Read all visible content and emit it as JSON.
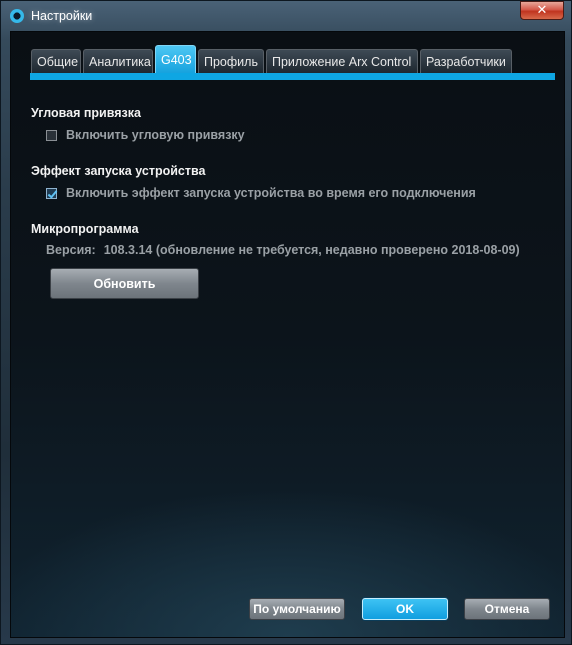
{
  "window": {
    "title": "Настройки",
    "close_label": "✕"
  },
  "tabs": [
    {
      "label": "Общие"
    },
    {
      "label": "Аналитика"
    },
    {
      "label": "G403"
    },
    {
      "label": "Профиль"
    },
    {
      "label": "Приложение Arx Control"
    },
    {
      "label": "Разработчики"
    }
  ],
  "active_tab": "G403",
  "angle_snapping": {
    "title": "Угловая привязка",
    "checkbox_label": "Включить угловую привязку",
    "checked": false
  },
  "startup_effect": {
    "title": "Эффект запуска устройства",
    "checkbox_label": "Включить эффект запуска устройства во время его подключения",
    "checked": true
  },
  "firmware": {
    "title": "Микропрограмма",
    "version_label": "Версия:",
    "version_value": "108.3.14 (обновление не требуется, недавно проверено 2018-08-09)",
    "update_label": "Обновить"
  },
  "footer": {
    "defaults_label": "По умолчанию",
    "ok_label": "OK",
    "cancel_label": "Отмена"
  },
  "colors": {
    "accent": "#0ea6e3",
    "background": "#0a0f14"
  },
  "icons": {
    "app": "logitech-g-icon",
    "close": "close-icon",
    "check": "checkmark-icon"
  }
}
